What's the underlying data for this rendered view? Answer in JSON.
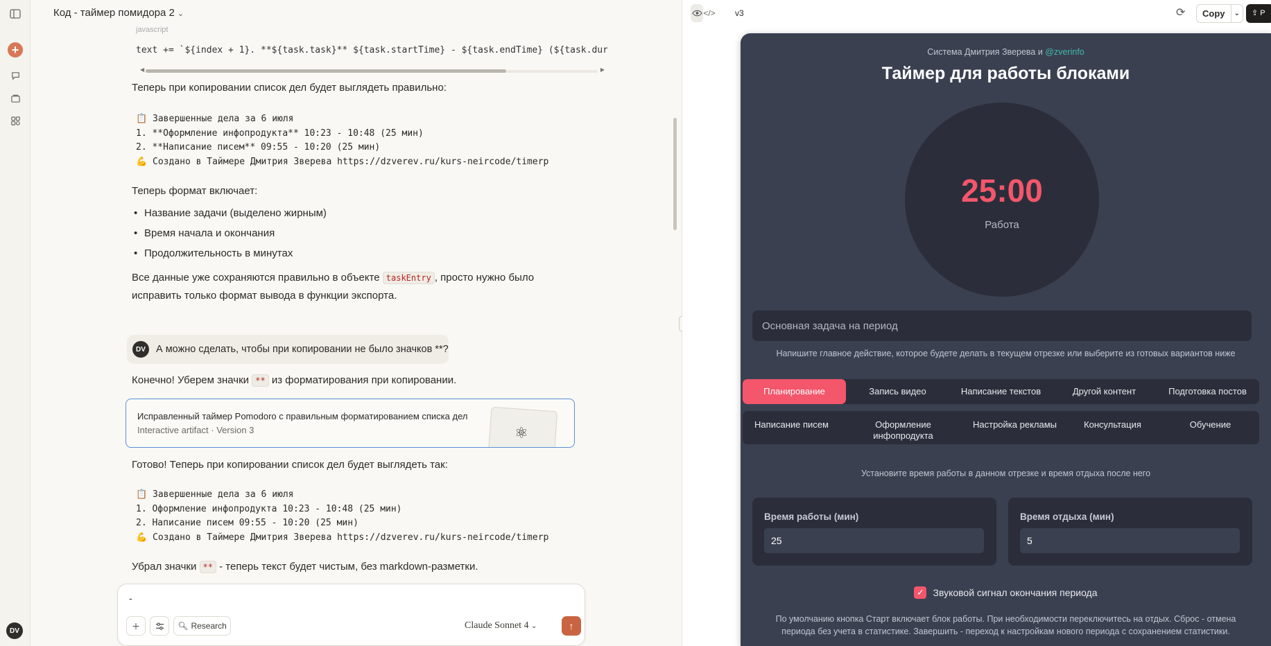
{
  "chat": {
    "title": "Код - таймер помидора 2",
    "code_lang": "javascript",
    "code_line_prefix": "text += `${index + 1}. ",
    "code_line_rest": "**${task.task}** ${task.startTime} - ${task.endTime} (${task.dur",
    "p1": "Теперь при копировании список дел будет выглядеть правильно:",
    "pre1": "📋 Завершенные дела за 6 июля\n1. **Оформление инфопродукта** 10:23 - 10:48 (25 мин)\n2. **Написание писем** 09:55 - 10:20 (25 мин)\n💪 Создано в Таймере Дмитрия Зверева https://dzverev.ru/kurs-neircode/timerp",
    "p2": "Теперь формат включает:",
    "bullets": [
      "Название задачи (выделено жирным)",
      "Время начала и окончания",
      "Продолжительность в минутах"
    ],
    "p3_before": "Все данные уже сохраняются правильно в объекте ",
    "p3_code": "taskEntry",
    "p3_after": ", просто нужно было",
    "p3_line2": "исправить только формат вывода в функции экспорта.",
    "user_initials": "DV",
    "user_message": "А можно сделать, чтобы при копировании не было значков **?",
    "p4_before": "Конечно! Уберем значки ",
    "p4_code": "**",
    "p4_after": " из форматирования при копировании.",
    "artifact_title": "Исправленный таймер Pomodoro с правильным форматированием списка дел",
    "artifact_type": "Interactive artifact",
    "artifact_sep": "·",
    "artifact_version": "Version 3",
    "p5": "Готово! Теперь при копировании список дел будет выглядеть так:",
    "pre2": "📋 Завершенные дела за 6 июля\n1. Оформление инфопродукта 10:23 - 10:48 (25 мин)\n2. Написание писем 09:55 - 10:20 (25 мин)\n💪 Создано в Таймере Дмитрия Зверева https://dzverev.ru/kurs-neircode/timerp",
    "p6_before": "Убрал значки ",
    "p6_code": "**",
    "p6_after": " - теперь текст будет чистым, без markdown-разметки.",
    "composer_text": "-",
    "research_label": "Research",
    "model_label": "Claude Sonnet 4"
  },
  "rail": {
    "avatar": "DV"
  },
  "panel": {
    "version": "v3",
    "copy_label": "Copy",
    "publish_label": "P"
  },
  "app": {
    "credit_prefix": "Система Дмитрия Зверева и ",
    "credit_link": "@zverinfo",
    "title": "Таймер для работы блоками",
    "time": "25:00",
    "mode": "Работа",
    "task_placeholder": "Основная задача на период",
    "task_hint": "Напишите главное действие, которое будете делать в текущем отрезке или выберите из готовых вариантов ниже",
    "tabs_row1": [
      "Планирование",
      "Запись видео",
      "Написание текстов",
      "Другой контент",
      "Подготовка постов"
    ],
    "tabs_row2": [
      "Написание писем",
      "Оформление инфопродукта",
      "Настройка рекламы",
      "Консультация",
      "Обучение"
    ],
    "time_hint": "Установите время работы в данном отрезке и время отдыха после него",
    "work_label": "Время работы (мин)",
    "work_value": "25",
    "rest_label": "Время отдыха (мин)",
    "rest_value": "5",
    "sound_label": "Звуковой сигнал окончания периода",
    "sound_checked": true,
    "footnote": "По умолчанию кнопка Старт включает блок работы. При необходимости переключитесь на отдых. Сброс - отмена периода без учета в статистике. Завершить - переход к настройкам нового периода с сохранением статистики."
  }
}
